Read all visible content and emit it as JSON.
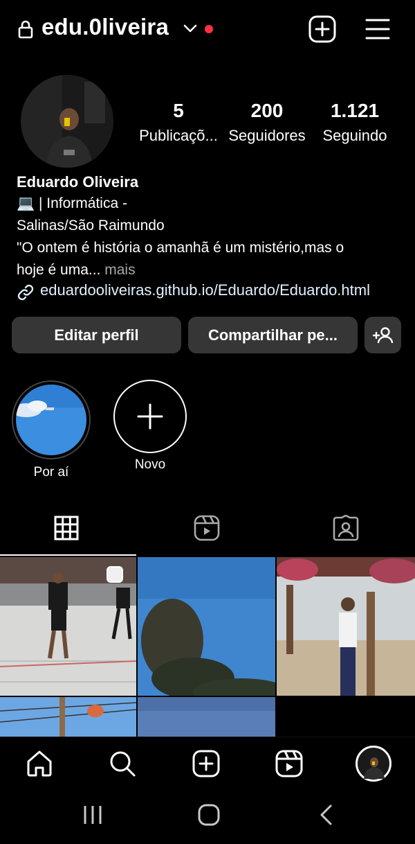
{
  "header": {
    "username": "edu.0liveira",
    "icons": [
      "lock-icon",
      "chevron-down-icon",
      "notification-dot",
      "create-icon",
      "menu-icon"
    ]
  },
  "profile": {
    "display_name": "Eduardo Oliveira",
    "bio_line1": "💻 | Informática -",
    "bio_line2": "Salinas/São Raimundo",
    "bio_line3": "\"O ontem é história o amanhã é um mistério,mas o",
    "bio_line4": "hoje é uma...",
    "bio_more": " mais",
    "link": "eduardooliveiras.github.io/Eduardo/Eduardo.html"
  },
  "stats": {
    "posts_count": "5",
    "posts_label": "Publicaçõ...",
    "followers_count": "200",
    "followers_label": "Seguidores",
    "following_count": "1.121",
    "following_label": "Seguindo"
  },
  "actions": {
    "edit_label": "Editar perfil",
    "share_label": "Compartilhar pe..."
  },
  "highlights": [
    {
      "label": "Por aí"
    },
    {
      "label": "Novo"
    }
  ],
  "tabs": [
    "grid-icon",
    "reels-icon",
    "tagged-icon"
  ],
  "bottom_nav": [
    "home-icon",
    "search-icon",
    "create-icon",
    "reels-icon",
    "profile-avatar"
  ],
  "system_nav": [
    "recents-icon",
    "home-circle-icon",
    "back-icon"
  ],
  "colors": {
    "background": "#000000",
    "button_bg": "#363636",
    "link": "#e0f1ff",
    "notification": "#ff3040",
    "muted": "#a8a8a8"
  }
}
